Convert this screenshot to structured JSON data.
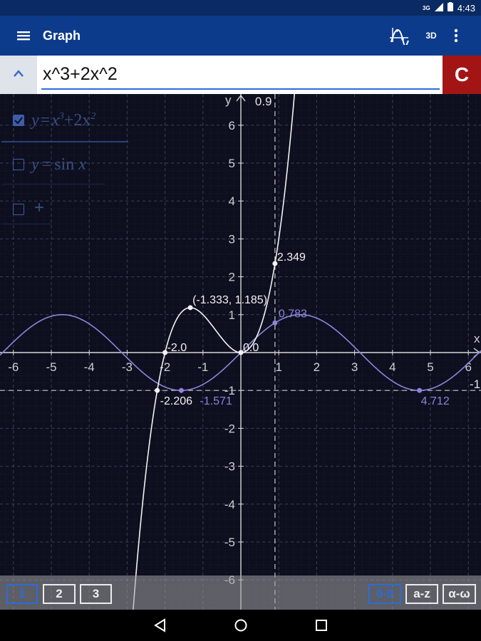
{
  "status": {
    "network": "3G",
    "time": "4:43"
  },
  "appbar": {
    "title": "Graph",
    "mode_3d_label": "3D",
    "menu_icon": "hamburger-menu-icon",
    "graph_tool_icon": "function-plot-icon",
    "more_icon": "more-vert-icon"
  },
  "input": {
    "expression": "x^3+2x^2",
    "clear_label": "C",
    "collapse_icon": "chevron-up-icon"
  },
  "equations": [
    {
      "checked": true,
      "lhs": "y",
      "eq": "=",
      "text1": "x",
      "sup1": "3",
      "text2": "+2x",
      "sup2": "2"
    },
    {
      "checked": false,
      "lhs": "y",
      "eq": "=",
      "text1": "sin",
      "var": "x"
    },
    {
      "checked": false,
      "add_label": "+"
    }
  ],
  "graph": {
    "x_ticks": [
      "-6",
      "-5",
      "-4",
      "-3",
      "-2",
      "-1",
      "1",
      "2",
      "3",
      "4",
      "5",
      "6"
    ],
    "y_ticks": [
      "6",
      "5",
      "4",
      "3",
      "2",
      "1",
      "-1",
      "-2",
      "-3",
      "-4",
      "-5",
      "-6"
    ],
    "x_axis_label": "x",
    "y_axis_label": "y",
    "edge_labels": {
      "top": "0.9",
      "right": "-1"
    },
    "series": [
      {
        "expression": "x^3+2x^2",
        "color": "#f2f2f2"
      },
      {
        "expression": "sin x",
        "color": "#8b86d9"
      }
    ],
    "points": [
      {
        "series": 0,
        "x": -2.206,
        "y": -1,
        "label": "-2.206"
      },
      {
        "series": 0,
        "x": -2.0,
        "y": 0,
        "label": "-2.0"
      },
      {
        "series": 0,
        "x": -1.333,
        "y": 1.185,
        "label": "(-1.333, 1.185)"
      },
      {
        "series": 0,
        "x": 0,
        "y": 0,
        "label": "0.0"
      },
      {
        "series": 0,
        "x": 0.9,
        "y": 2.349,
        "label": "2.349"
      },
      {
        "series": 1,
        "x": -1.571,
        "y": -1,
        "label": "-1.571"
      },
      {
        "series": 1,
        "x": 0.9,
        "y": 0.783,
        "label": "0.783"
      },
      {
        "series": 1,
        "x": 4.712,
        "y": -1,
        "label": "4.712"
      }
    ],
    "vertical_line_x": 0.9,
    "horizontal_line_y": -1
  },
  "keyboard": {
    "tabs": [
      "1",
      "2",
      "3"
    ],
    "right_tabs": [
      "0-9",
      "a-z",
      "α-ω"
    ],
    "active_tab": "1",
    "active_right_tab": "0-9"
  },
  "nav": {
    "back_icon": "back-triangle-icon",
    "home_icon": "home-circle-icon",
    "recents_icon": "recents-square-icon"
  },
  "colors": {
    "appbar": "#0d3b8c",
    "statusbar": "#0a2a63",
    "graph_bg": "#0d0f1f",
    "clear": "#a31515",
    "accent": "#2b6dd8",
    "curve1": "#f2f2f2",
    "curve2": "#8b86d9"
  }
}
